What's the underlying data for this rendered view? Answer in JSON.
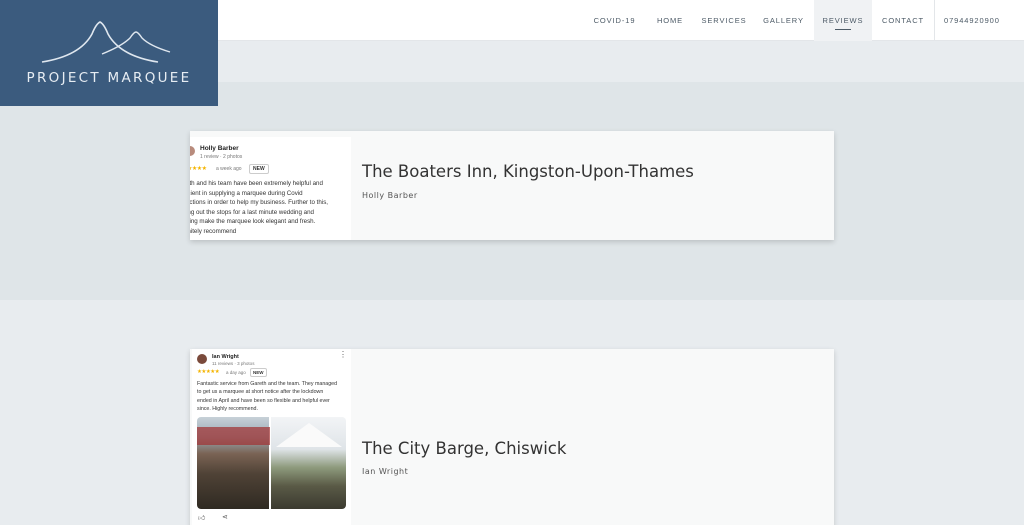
{
  "brand": {
    "name": "PROJECT MARQUEE",
    "bg": "#3b5b7e"
  },
  "nav": {
    "items": [
      {
        "label": "COVID-19"
      },
      {
        "label": "HOME"
      },
      {
        "label": "SERVICES"
      },
      {
        "label": "GALLERY"
      },
      {
        "label": "REVIEWS",
        "active": true
      },
      {
        "label": "CONTACT"
      }
    ],
    "phone": "07944920900"
  },
  "reviews": [
    {
      "title": "The Boaters Inn, Kingston-Upon-Thames",
      "author": "Holly Barber",
      "snippet": {
        "name": "Holly Barber",
        "meta": "1 review · 2 photos",
        "stars": "★★★★",
        "when": "a week ago",
        "badge": "NEW",
        "text": "eth and his team have been extremely helpful and\nicient in supplying a marquee during Covid\nrictions in order to help my business. Further to this,\ning out the stops for a last minute wedding and\nping make the marquee look elegant and fresh.\ninitely recommend"
      }
    },
    {
      "title": "The City Barge, Chiswick",
      "author": "Ian Wright",
      "snippet": {
        "name": "Ian Wright",
        "meta": "11 reviews · 3 photos",
        "stars": "★★★★★",
        "when": "a day ago",
        "badge": "NEW",
        "text": "Fantastic service from Gareth and the team. They managed\nto get us a marquee at short notice after the lockdown\nended in April and have been so flexible and helpful ever\nsince. Highly recommend."
      }
    }
  ]
}
